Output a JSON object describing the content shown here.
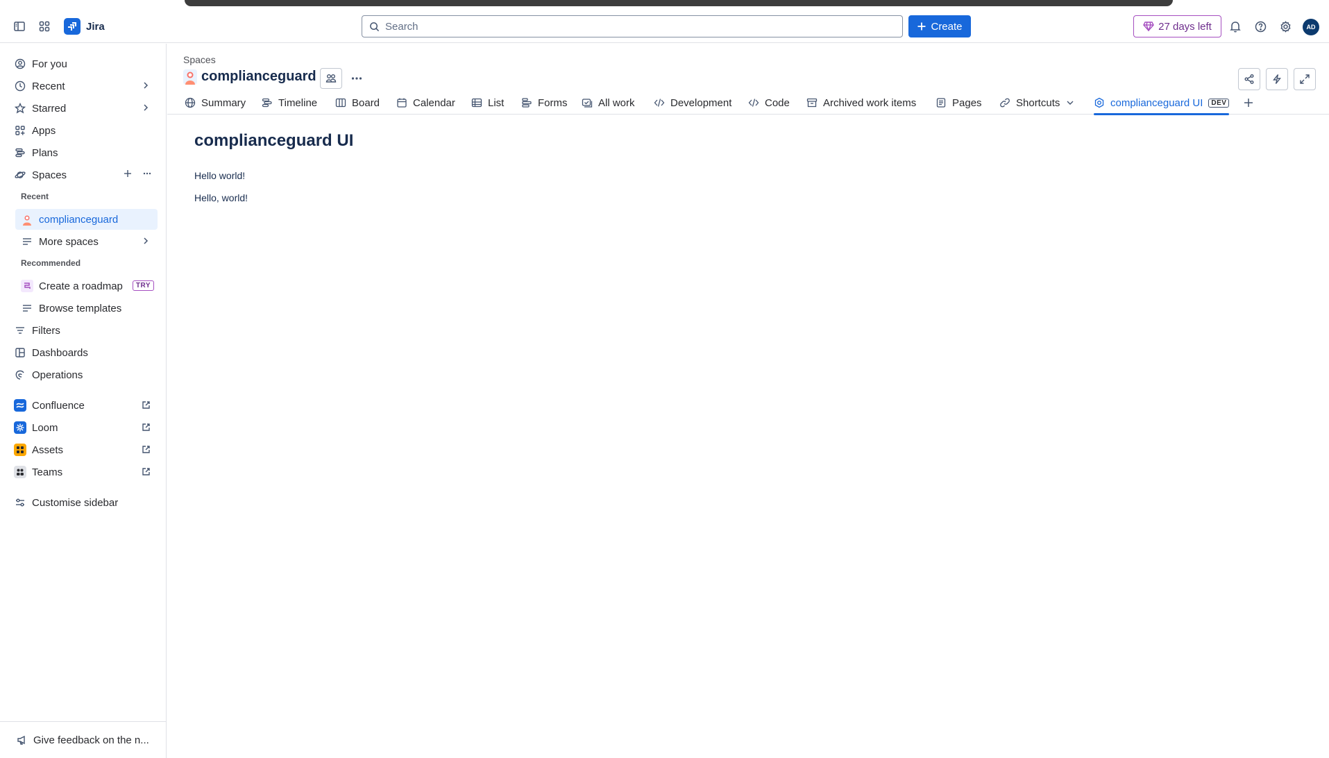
{
  "header": {
    "app_name": "Jira",
    "search_placeholder": "Search",
    "create_label": "Create",
    "trial_label": "27 days left",
    "avatar_initials": "AD"
  },
  "sidebar": {
    "items": [
      {
        "label": "For you",
        "icon": "user-circle-icon"
      },
      {
        "label": "Recent",
        "icon": "clock-icon"
      },
      {
        "label": "Starred",
        "icon": "star-icon"
      },
      {
        "label": "Apps",
        "icon": "apps-icon"
      },
      {
        "label": "Plans",
        "icon": "plans-icon"
      },
      {
        "label": "Spaces",
        "icon": "spaces-icon"
      }
    ],
    "recent_label": "Recent",
    "recent_space": "complianceguard",
    "more_spaces": "More spaces",
    "recommended_label": "Recommended",
    "create_roadmap": "Create a roadmap",
    "try_badge": "TRY",
    "browse_templates": "Browse templates",
    "lower_items": [
      {
        "label": "Filters",
        "icon": "filter-icon"
      },
      {
        "label": "Dashboards",
        "icon": "dashboard-icon"
      },
      {
        "label": "Operations",
        "icon": "operations-icon"
      }
    ],
    "apps": [
      {
        "label": "Confluence",
        "color": "#1868db"
      },
      {
        "label": "Loom",
        "color": "#1868db"
      },
      {
        "label": "Assets",
        "color": "#fca700"
      },
      {
        "label": "Teams",
        "color": "#dfe1e6"
      }
    ],
    "customise": "Customise sidebar",
    "feedback": "Give feedback on the n..."
  },
  "main": {
    "breadcrumb": "Spaces",
    "space_name": "complianceguard",
    "tabs": [
      {
        "label": "Summary",
        "icon": "globe-icon"
      },
      {
        "label": "Timeline",
        "icon": "timeline-icon"
      },
      {
        "label": "Board",
        "icon": "board-icon"
      },
      {
        "label": "Calendar",
        "icon": "calendar-icon"
      },
      {
        "label": "List",
        "icon": "list-icon"
      },
      {
        "label": "Forms",
        "icon": "forms-icon"
      },
      {
        "label": "All work",
        "icon": "all-work-icon"
      },
      {
        "label": "Development",
        "icon": "development-icon"
      },
      {
        "label": "Code",
        "icon": "code-icon"
      },
      {
        "label": "Archived work items",
        "icon": "archive-icon"
      },
      {
        "label": "Pages",
        "icon": "pages-icon"
      },
      {
        "label": "Shortcuts",
        "icon": "link-icon"
      },
      {
        "label": "complianceguard UI",
        "icon": "app-tab-icon",
        "badge": "DEV"
      }
    ],
    "page_heading": "complianceguard UI",
    "paragraphs": [
      "Hello world!",
      "Hello, world!"
    ]
  },
  "colors": {
    "accent": "#1868db",
    "trial": "#a54ec0",
    "text": "#172b4d"
  }
}
